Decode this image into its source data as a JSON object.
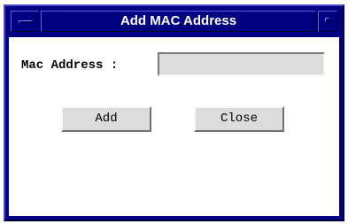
{
  "window": {
    "title": "Add MAC Address"
  },
  "form": {
    "mac_label": "Mac Address :",
    "mac_value": "",
    "mac_placeholder": ""
  },
  "buttons": {
    "add_label": "Add",
    "close_label": "Close"
  },
  "icons": {
    "window_menu": "window-menu-icon",
    "maximize": "maximize-icon"
  },
  "colors": {
    "titlebar": "#000080",
    "title_text": "#ffffff",
    "button_face": "#dcdcdc",
    "input_face": "#dcdcdc"
  }
}
